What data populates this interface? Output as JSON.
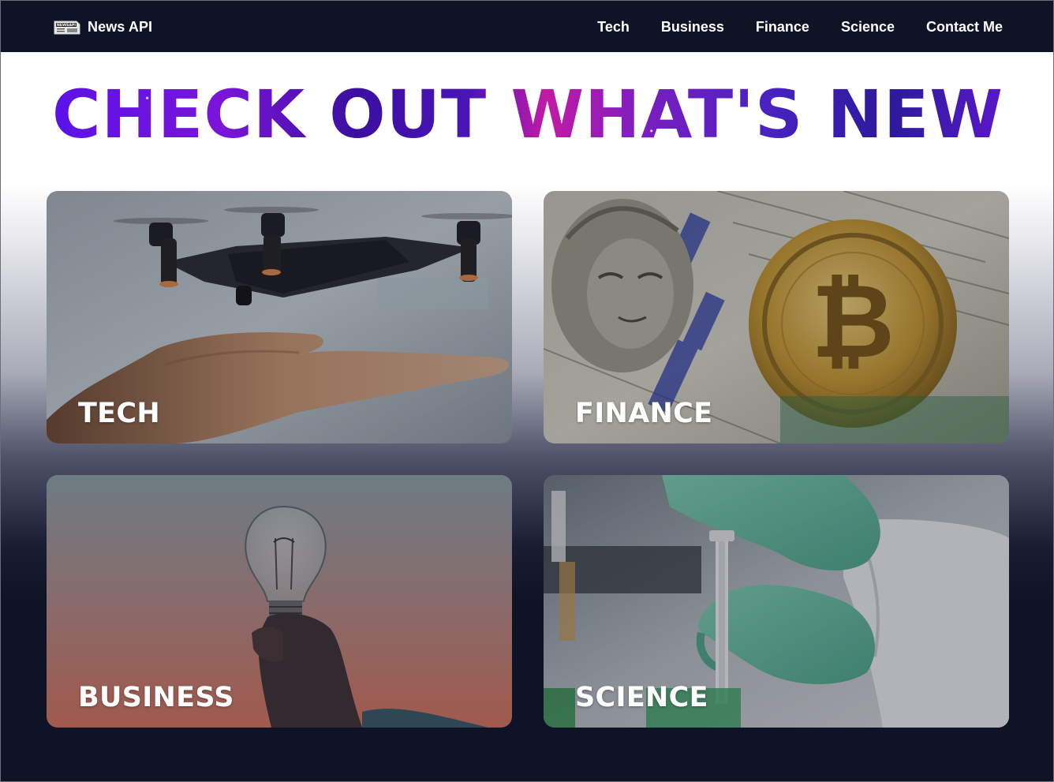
{
  "brand": {
    "name": "News API",
    "logo_icon": "newspaper-icon",
    "logo_text": "NEWSAPI"
  },
  "nav": {
    "items": [
      {
        "label": "Tech"
      },
      {
        "label": "Business"
      },
      {
        "label": "Finance"
      },
      {
        "label": "Science"
      },
      {
        "label": "Contact Me"
      }
    ]
  },
  "hero": {
    "title": "CHECK OUT WHAT'S NEW"
  },
  "cards": {
    "tech": {
      "label": "TECH",
      "image": "drone-over-hand"
    },
    "finance": {
      "label": "FINANCE",
      "image": "bitcoin-on-dollar-bills"
    },
    "business": {
      "label": "BUSINESS",
      "image": "hand-holding-lightbulb"
    },
    "science": {
      "label": "SCIENCE",
      "image": "gloved-hands-lab-pipette"
    }
  },
  "colors": {
    "navbar_bg": "#0f1326",
    "page_bottom_bg": "#0f1326",
    "title_gradient_start": "#5a12e8",
    "title_gradient_mid": "#c21aa6",
    "title_gradient_end": "#2a1a9a",
    "label_text": "#ffffff"
  }
}
